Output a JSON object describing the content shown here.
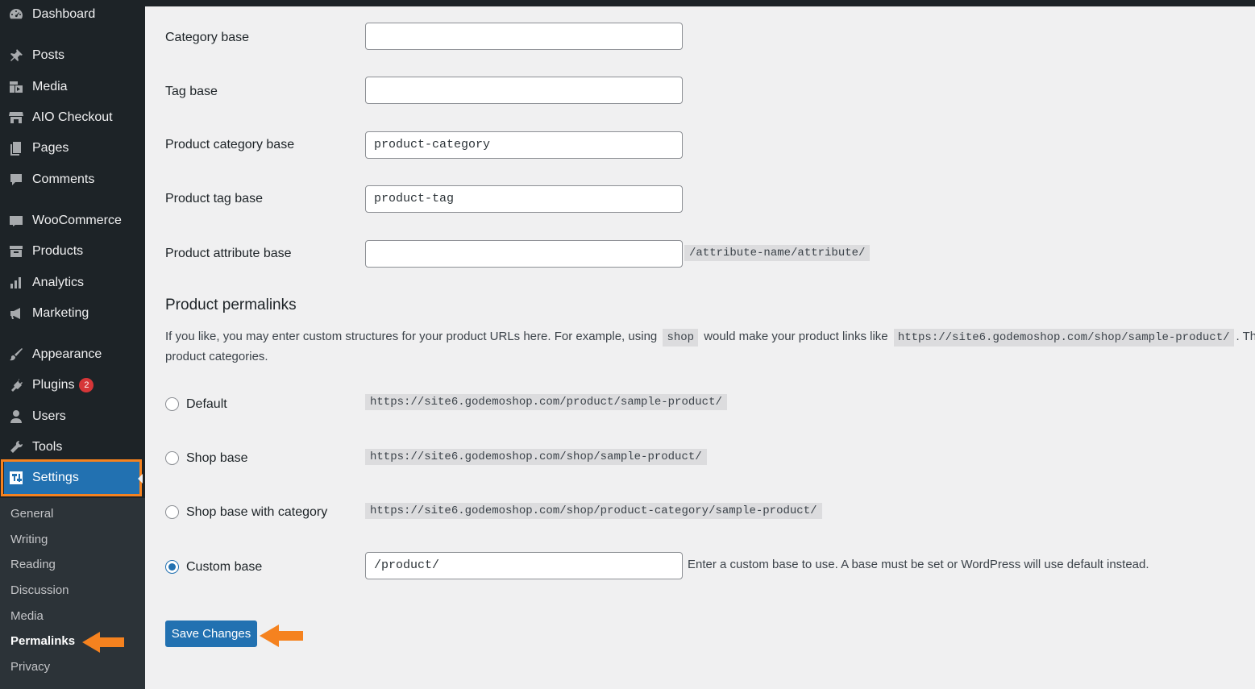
{
  "sidebar": {
    "items": [
      {
        "label": "Dashboard",
        "icon": "dashboard-icon"
      },
      {
        "label": "Posts",
        "icon": "pin-icon"
      },
      {
        "label": "Media",
        "icon": "media-icon"
      },
      {
        "label": "AIO Checkout",
        "icon": "store-icon"
      },
      {
        "label": "Pages",
        "icon": "pages-icon"
      },
      {
        "label": "Comments",
        "icon": "comment-icon"
      },
      {
        "label": "WooCommerce",
        "icon": "woo-icon"
      },
      {
        "label": "Products",
        "icon": "archive-icon"
      },
      {
        "label": "Analytics",
        "icon": "bar-chart-icon"
      },
      {
        "label": "Marketing",
        "icon": "megaphone-icon"
      },
      {
        "label": "Appearance",
        "icon": "brush-icon"
      },
      {
        "label": "Plugins",
        "icon": "plug-icon",
        "badge": "2"
      },
      {
        "label": "Users",
        "icon": "user-icon"
      },
      {
        "label": "Tools",
        "icon": "wrench-icon"
      },
      {
        "label": "Settings",
        "icon": "settings-icon"
      }
    ],
    "submenu": [
      "General",
      "Writing",
      "Reading",
      "Discussion",
      "Media",
      "Permalinks",
      "Privacy"
    ],
    "current_submenu": "Permalinks"
  },
  "form": {
    "category_base": {
      "label": "Category base",
      "value": ""
    },
    "tag_base": {
      "label": "Tag base",
      "value": ""
    },
    "product_category_base": {
      "label": "Product category base",
      "value": "product-category"
    },
    "product_tag_base": {
      "label": "Product tag base",
      "value": "product-tag"
    },
    "product_attribute_base": {
      "label": "Product attribute base",
      "value": "",
      "suffix": "/attribute-name/attribute/"
    }
  },
  "product_permalinks": {
    "heading": "Product permalinks",
    "desc_part1": "If you like, you may enter custom structures for your product URLs here. For example, using",
    "desc_code1": "shop",
    "desc_part2": "would make your product links like",
    "desc_code2": "https://site6.godemoshop.com/shop/sample-product/",
    "desc_part3": ". This setting",
    "desc_line2": "product categories.",
    "options": [
      {
        "label": "Default",
        "example": "https://site6.godemoshop.com/product/sample-product/",
        "checked": false
      },
      {
        "label": "Shop base",
        "example": "https://site6.godemoshop.com/shop/sample-product/",
        "checked": false
      },
      {
        "label": "Shop base with category",
        "example": "https://site6.godemoshop.com/shop/product-category/sample-product/",
        "checked": false
      },
      {
        "label": "Custom base",
        "value": "/product/",
        "checked": true
      }
    ],
    "custom_help": "Enter a custom base to use. A base must be set or WordPress will use default instead."
  },
  "save_button": "Save Changes",
  "colors": {
    "accent": "#2271b1",
    "annotation": "#f5821f",
    "sidebar": "#1d2327"
  }
}
